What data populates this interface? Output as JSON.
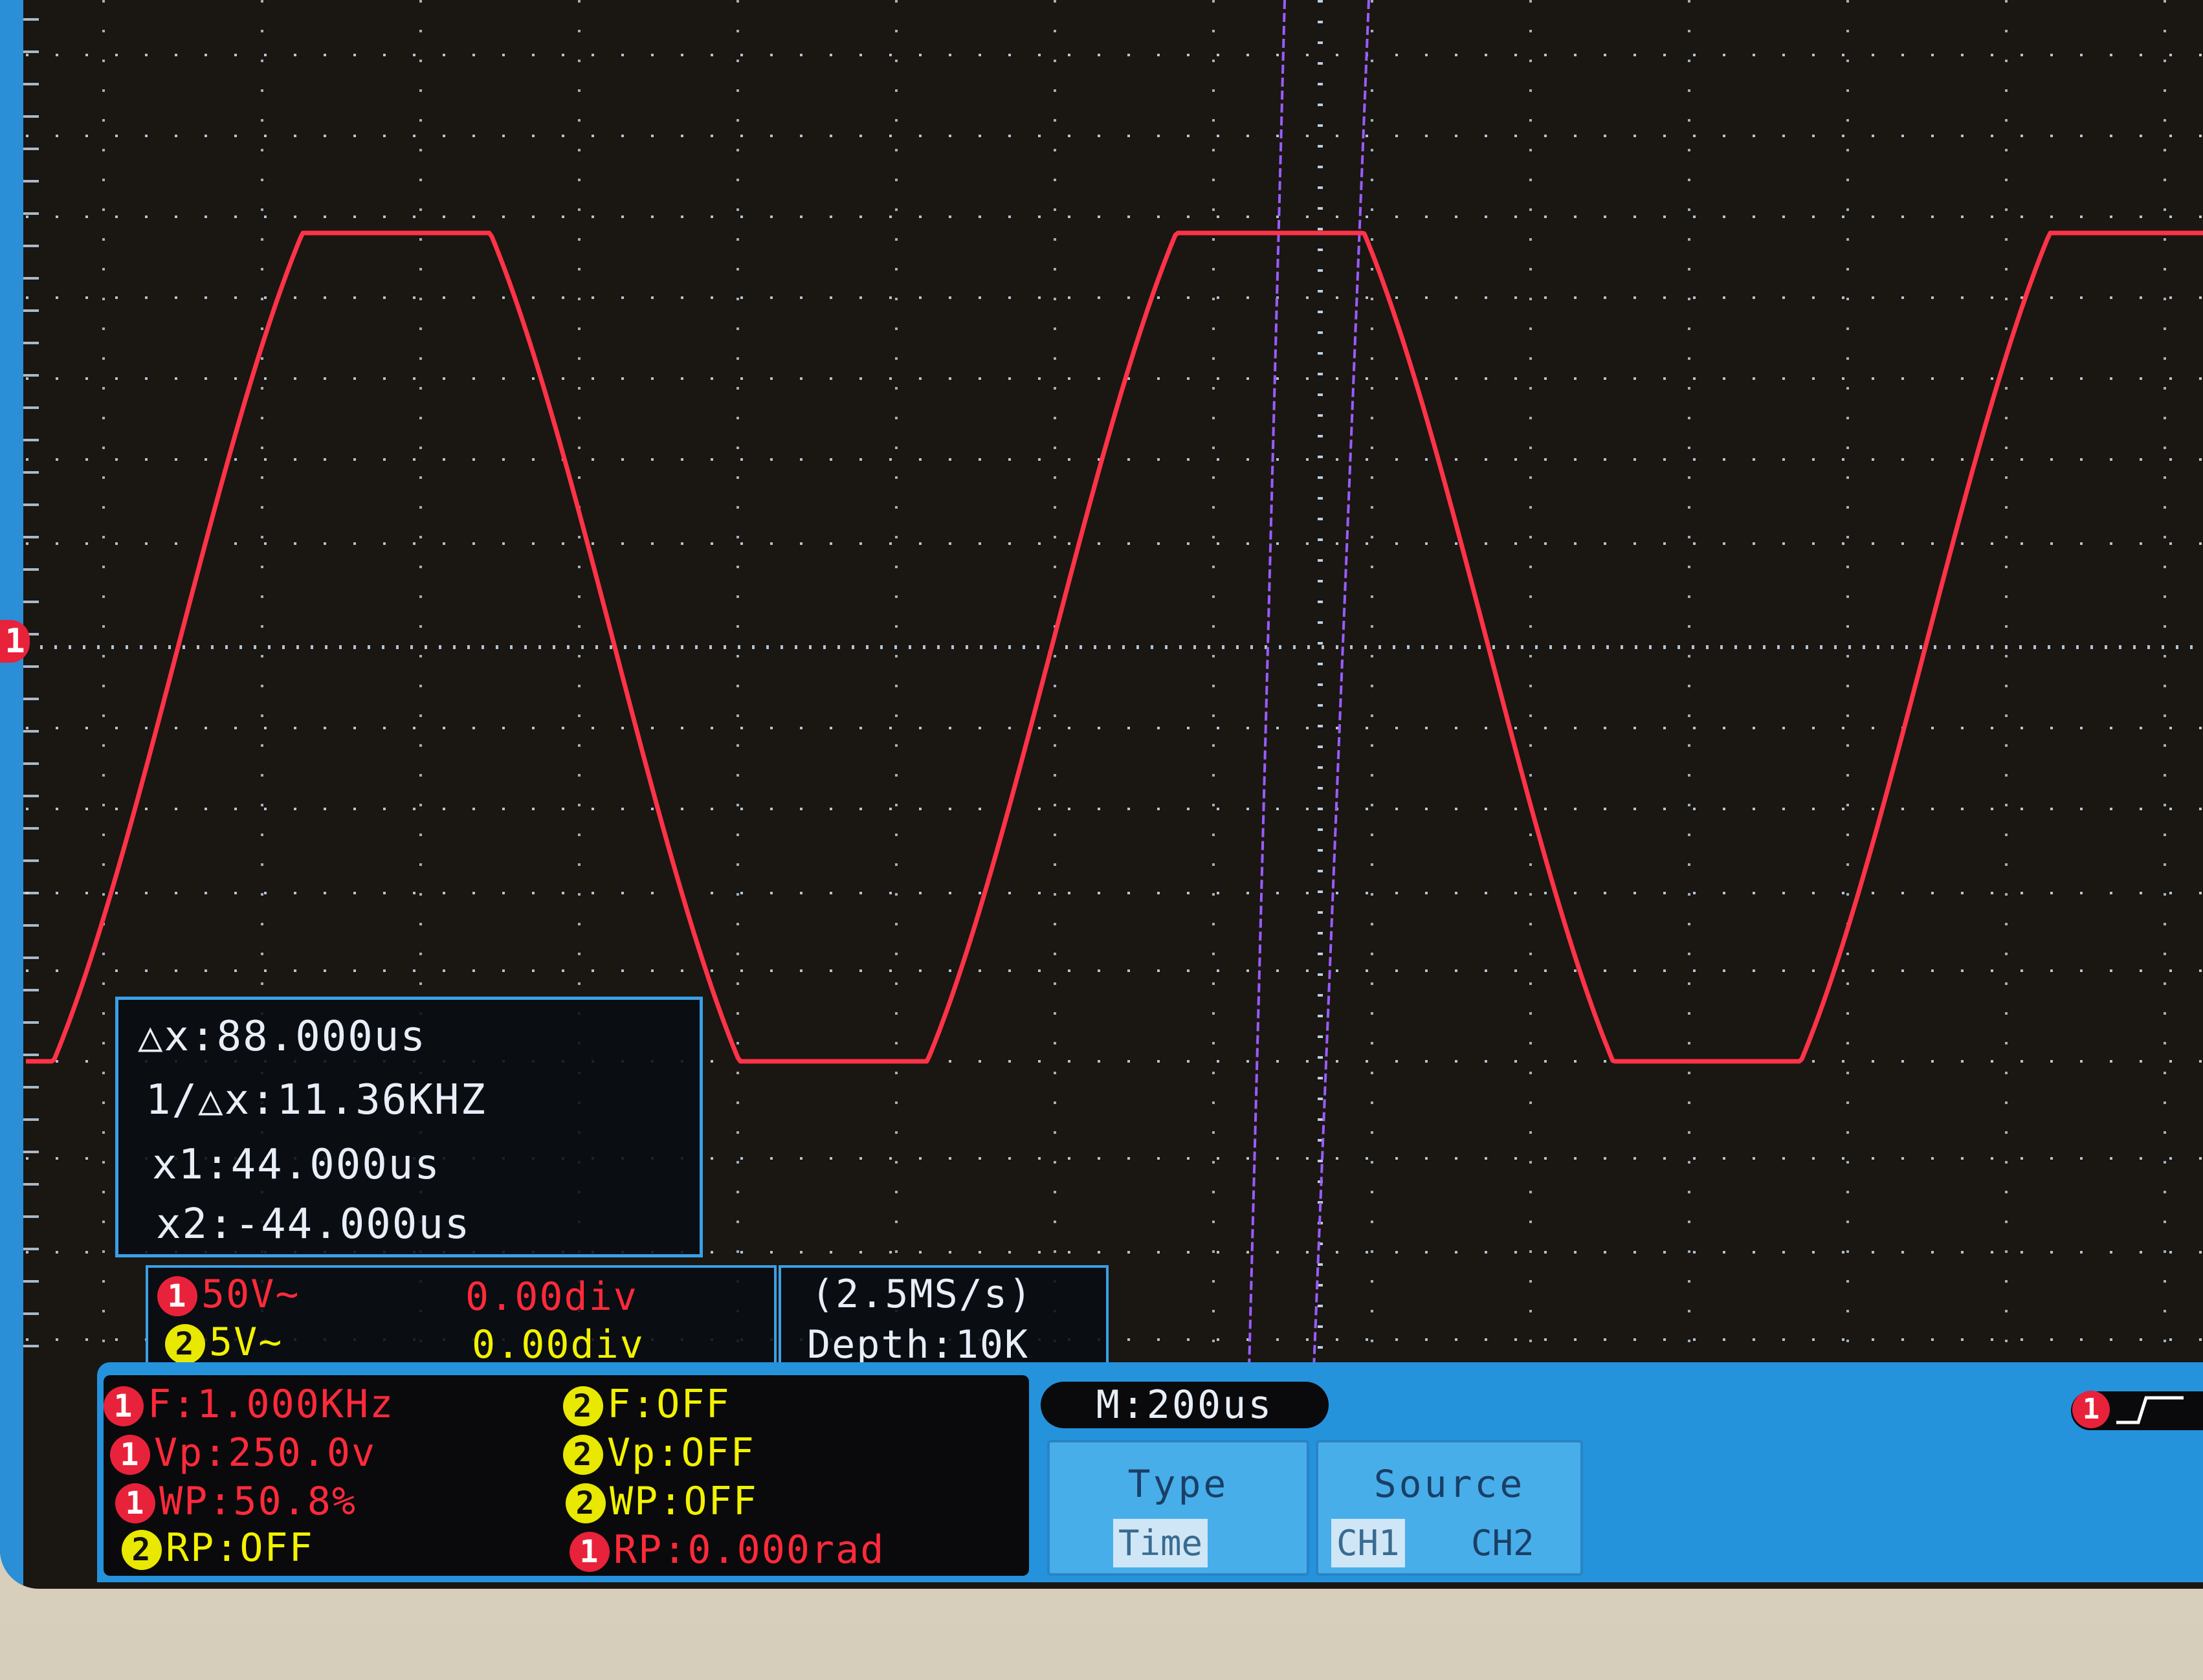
{
  "cursor_readout": {
    "delta_x": "△x:88.000us",
    "inverse_delta_x": "1/△x:11.36KHZ",
    "x1": "x1:44.000us",
    "x2": "x2:-44.000us"
  },
  "channels": {
    "ch1": {
      "number": "1",
      "scale": "50V~",
      "offset": "0.00div"
    },
    "ch2": {
      "number": "2",
      "scale": "5V~",
      "offset": "0.00div"
    }
  },
  "acquisition": {
    "sample_rate": "(2.5MS/s)",
    "depth": "Depth:10K"
  },
  "measurements": {
    "ch1_freq": "F:1.000KHz",
    "ch1_vp": "Vp:250.0v",
    "ch1_wp": "WP:50.8%",
    "ch2_rp": "RP:OFF",
    "ch2_freq": "F:OFF",
    "ch2_vp": "Vp:OFF",
    "ch2_wp": "WP:OFF",
    "ch1_rp": "RP:0.000rad"
  },
  "timebase": "M:200us",
  "softkeys": {
    "type": {
      "title": "Type",
      "options": [
        "Time"
      ],
      "selected": "Time"
    },
    "source": {
      "title": "Source",
      "options": [
        "CH1",
        "CH2"
      ],
      "selected": "CH1"
    }
  },
  "markers": {
    "ch1": "1",
    "trigger_channel": "1"
  },
  "waveform": {
    "color": "#ff3347",
    "shape": "clipped-sine",
    "frequency_khz": 1.0,
    "cursor_color": "#9a5cff"
  },
  "colors": {
    "ch1": "#ff2a3a",
    "ch2": "#f2f200",
    "accent": "#2a8fd6",
    "grid": "#cfe2f5"
  }
}
